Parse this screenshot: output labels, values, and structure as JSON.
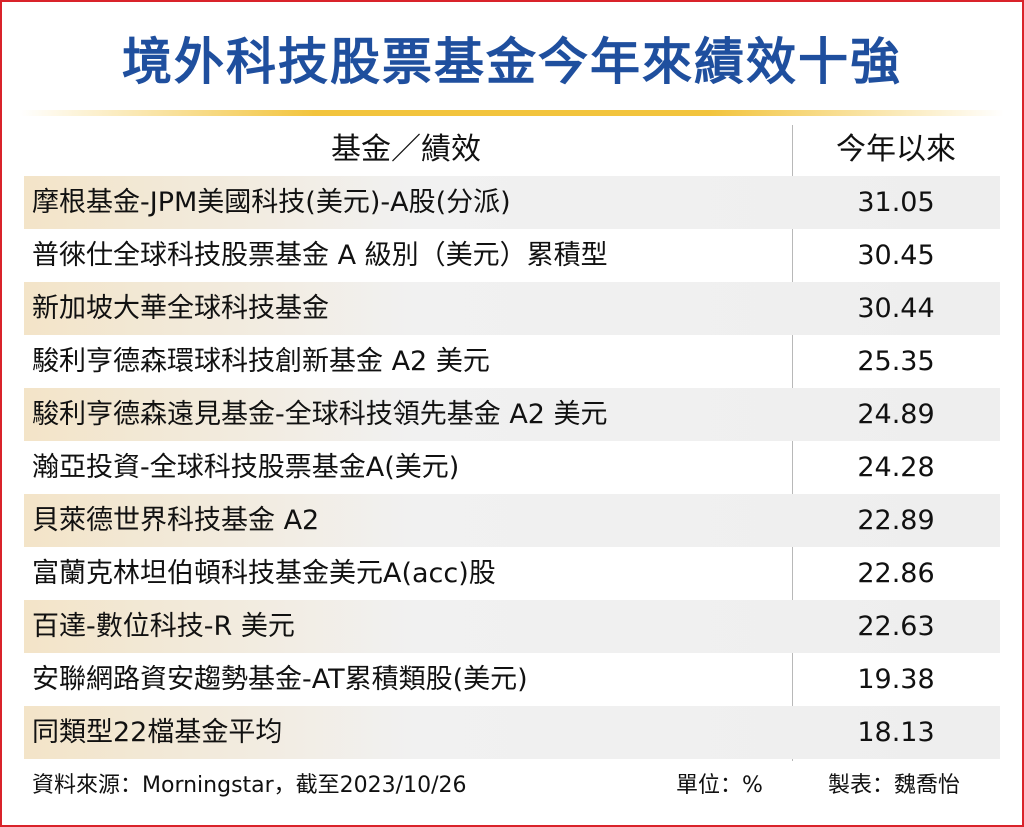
{
  "chart_data": {
    "type": "table",
    "title": "境外科技股票基金今年來績效十強",
    "columns": [
      "基金／績效",
      "今年以來"
    ],
    "rows": [
      {
        "name": "摩根基金-JPM美國科技(美元)-A股(分派)",
        "value": "31.05"
      },
      {
        "name": "普徠仕全球科技股票基金 A 級別（美元）累積型",
        "value": "30.45"
      },
      {
        "name": "新加坡大華全球科技基金",
        "value": "30.44"
      },
      {
        "name": "駿利亨德森環球科技創新基金 A2 美元",
        "value": "25.35"
      },
      {
        "name": "駿利亨德森遠見基金-全球科技領先基金 A2 美元",
        "value": "24.89"
      },
      {
        "name": "瀚亞投資-全球科技股票基金A(美元)",
        "value": "24.28"
      },
      {
        "name": "貝萊德世界科技基金 A2",
        "value": "22.89"
      },
      {
        "name": "富蘭克林坦伯頓科技基金美元A(acc)股",
        "value": "22.86"
      },
      {
        "name": "百達-數位科技-R 美元",
        "value": "22.63"
      },
      {
        "name": "安聯網路資安趨勢基金-AT累積類股(美元)",
        "value": "19.38"
      },
      {
        "name": "同類型22檔基金平均",
        "value": "18.13"
      }
    ]
  },
  "footer": {
    "source": "資料來源：Morningstar，截至2023/10/26",
    "unit": "單位：%",
    "maker": "製表：魏喬怡"
  },
  "colors": {
    "title": "#1f4f9e",
    "frame": "#d9232a",
    "rule": "#f2c43d",
    "row_shade": "#eeeeee"
  }
}
